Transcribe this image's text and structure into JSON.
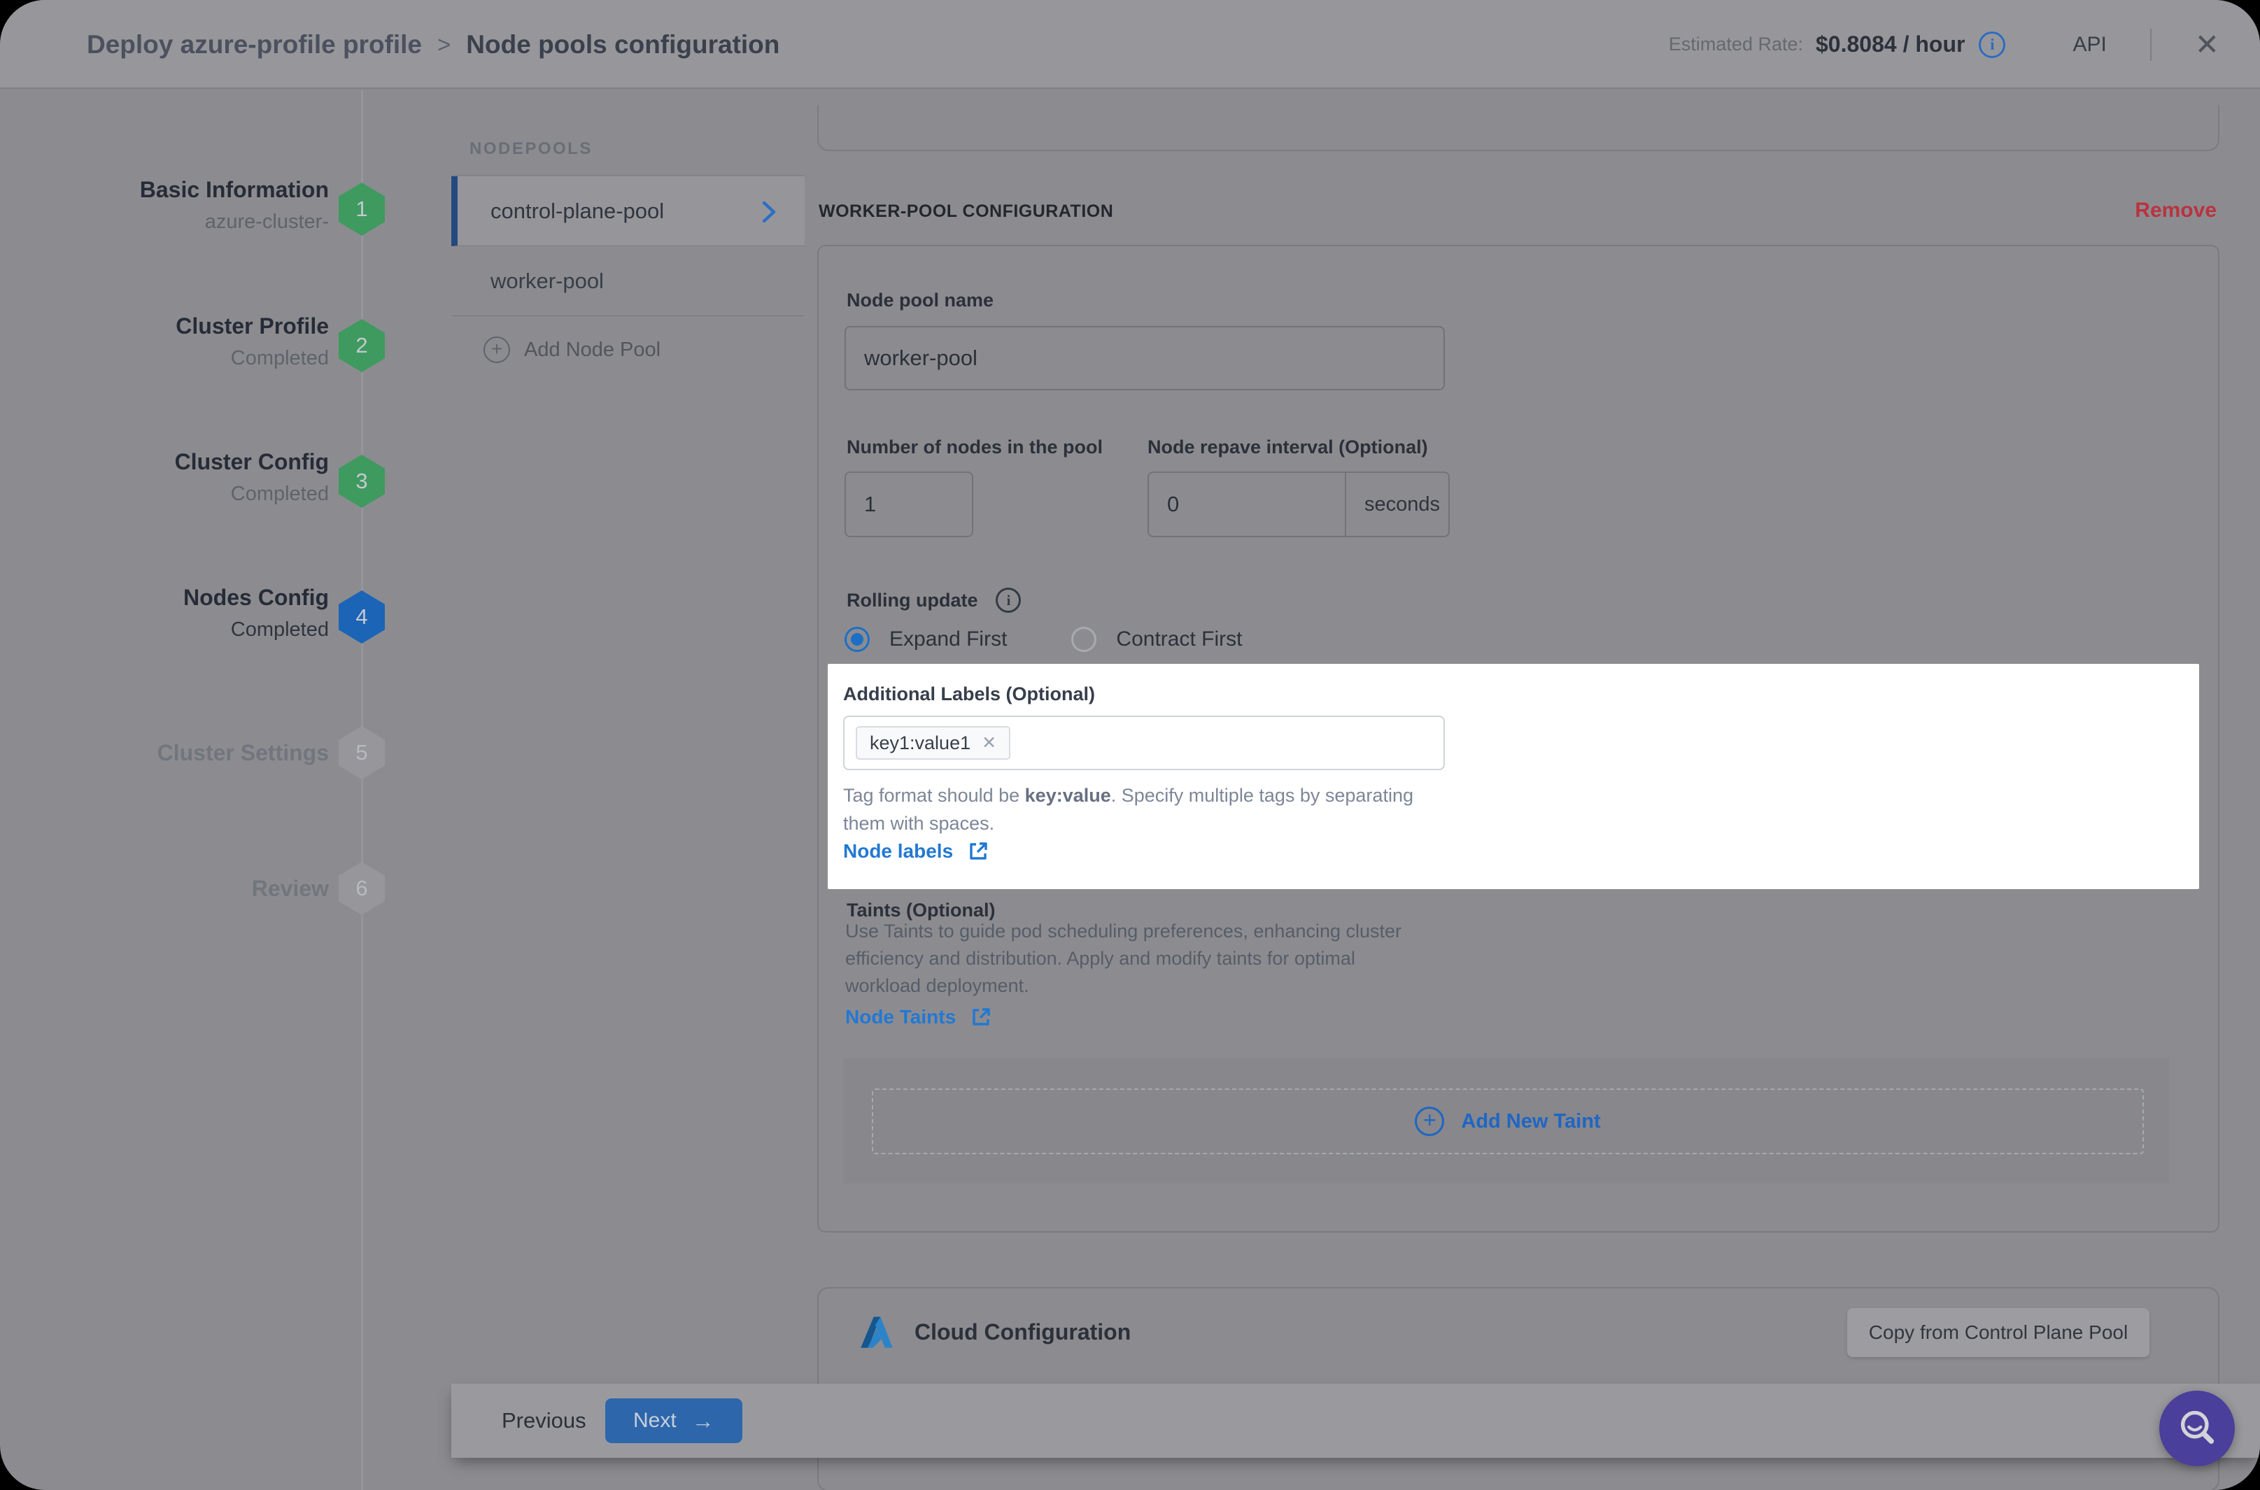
{
  "colors": {
    "spotlight_bg": "#ffffff",
    "accent_blue": "#2d66ab",
    "link_blue": "#2278d3",
    "success_green": "#3e9a5f",
    "current_step_blue": "#1c64b6",
    "remove_red": "#b93340",
    "fab_purple": "#4a3f9a"
  },
  "header": {
    "breadcrumb_primary": "Deploy azure-profile profile",
    "breadcrumb_separator": ">",
    "breadcrumb_current": "Node pools configuration",
    "estimated_rate_label": "Estimated Rate:",
    "estimated_rate_value": "$0.8084 / hour",
    "api_label": "API"
  },
  "stepper": {
    "steps": [
      {
        "num": "1",
        "title": "Basic Information",
        "subtitle": "azure-cluster-",
        "state": "done"
      },
      {
        "num": "2",
        "title": "Cluster Profile",
        "subtitle": "Completed",
        "state": "done"
      },
      {
        "num": "3",
        "title": "Cluster Config",
        "subtitle": "Completed",
        "state": "done"
      },
      {
        "num": "4",
        "title": "Nodes Config",
        "subtitle": "Completed",
        "state": "current"
      },
      {
        "num": "5",
        "title": "Cluster Settings",
        "subtitle": "",
        "state": "todo"
      },
      {
        "num": "6",
        "title": "Review",
        "subtitle": "",
        "state": "todo"
      }
    ]
  },
  "nodepools": {
    "heading": "NODEPOOLS",
    "items": [
      {
        "name": "control-plane-pool"
      },
      {
        "name": "worker-pool"
      }
    ],
    "add_button": "Add Node Pool"
  },
  "worker_pool": {
    "section_title": "WORKER-POOL CONFIGURATION",
    "remove_button": "Remove",
    "name_label": "Node pool name",
    "name_value": "worker-pool",
    "nodes_label": "Number of nodes in the pool",
    "nodes_value": "1",
    "repave_label": "Node repave interval (Optional)",
    "repave_value": "0",
    "repave_unit": "seconds",
    "rolling_update_label": "Rolling update",
    "rolling_options": [
      {
        "label": "Expand First",
        "selected": true
      },
      {
        "label": "Contract First",
        "selected": false
      }
    ]
  },
  "labels_section": {
    "title": "Additional Labels (Optional)",
    "tag_value": "key1:value1",
    "hint_prefix": "Tag format should be ",
    "hint_bold": "key:value",
    "hint_suffix": ". Specify multiple tags by separating",
    "hint_line2": "them with spaces.",
    "link": "Node labels"
  },
  "taints_section": {
    "title": "Taints (Optional)",
    "desc": [
      "Use Taints to guide pod scheduling preferences, enhancing cluster",
      "efficiency and distribution. Apply and modify taints for optimal",
      "workload deployment."
    ],
    "link": "Node Taints",
    "add_button": "Add New Taint"
  },
  "cloud_section": {
    "title": "Cloud Configuration",
    "copy_button": "Copy from Control Plane Pool"
  },
  "footer": {
    "previous_button": "Previous",
    "next_button": "Next"
  }
}
